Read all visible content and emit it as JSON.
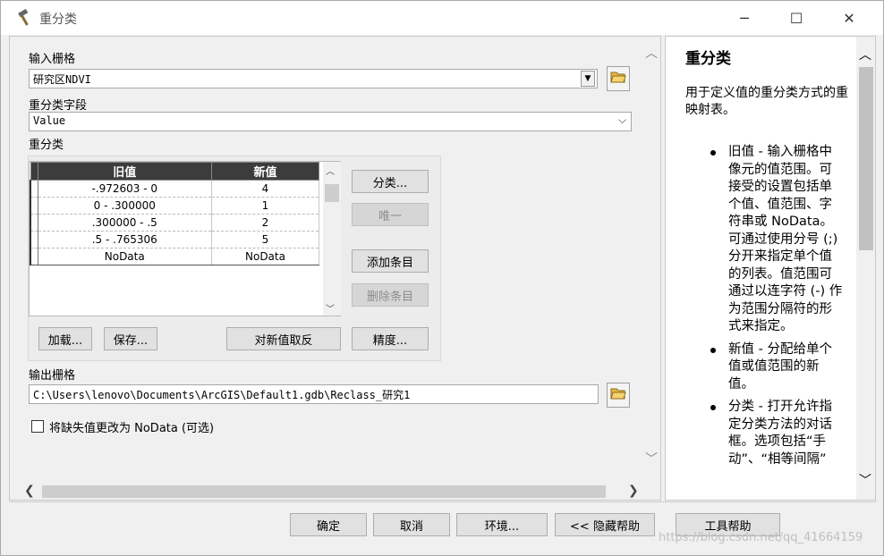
{
  "window": {
    "title": "重分类",
    "minimize_icon": "─",
    "maximize_icon": "☐",
    "close_icon": "✕"
  },
  "form": {
    "input_raster": {
      "label": "输入栅格",
      "value": "研究区NDVI"
    },
    "reclass_field": {
      "label": "重分类字段",
      "value": "Value"
    },
    "reclass_label": "重分类",
    "table": {
      "columns": [
        "旧值",
        "新值"
      ],
      "rows": [
        [
          "-.972603 - 0",
          "4"
        ],
        [
          "0 - .300000",
          "1"
        ],
        [
          ".300000 - .5",
          "2"
        ],
        [
          ".5 - .765306",
          "5"
        ],
        [
          "NoData",
          "NoData"
        ]
      ]
    },
    "buttons": {
      "classify": "分类...",
      "unique": "唯一",
      "add_entry": "添加条目",
      "delete_entry": "删除条目",
      "load": "加载...",
      "save": "保存...",
      "reverse": "对新值取反",
      "precision": "精度..."
    },
    "output_raster": {
      "label": "输出栅格",
      "value": "C:\\Users\\lenovo\\Documents\\ArcGIS\\Default1.gdb\\Reclass_研究1"
    },
    "missing_to_nodata": {
      "label": "将缺失值更改为 NoData (可选)",
      "checked": false
    }
  },
  "help": {
    "title": "重分类",
    "intro": "用于定义值的重分类方式的重映射表。",
    "items": [
      "旧值 - 输入栅格中像元的值范围。可接受的设置包括单个值、值范围、字符串或 NoData。可通过使用分号 (;) 分开来指定单个值的列表。值范围可通过以连字符 (-) 作为范围分隔符的形式来指定。",
      "新值 - 分配给单个值或值范围的新值。",
      "分类 - 打开允许指定分类方法的对话框。选项包括“手动”、“相等间隔”"
    ]
  },
  "footer": {
    "ok": "确定",
    "cancel": "取消",
    "env": "环境...",
    "hide_help": "<< 隐藏帮助",
    "tool_help": "工具帮助"
  },
  "watermark": "https://blog.csdn.net/qq_41664159"
}
